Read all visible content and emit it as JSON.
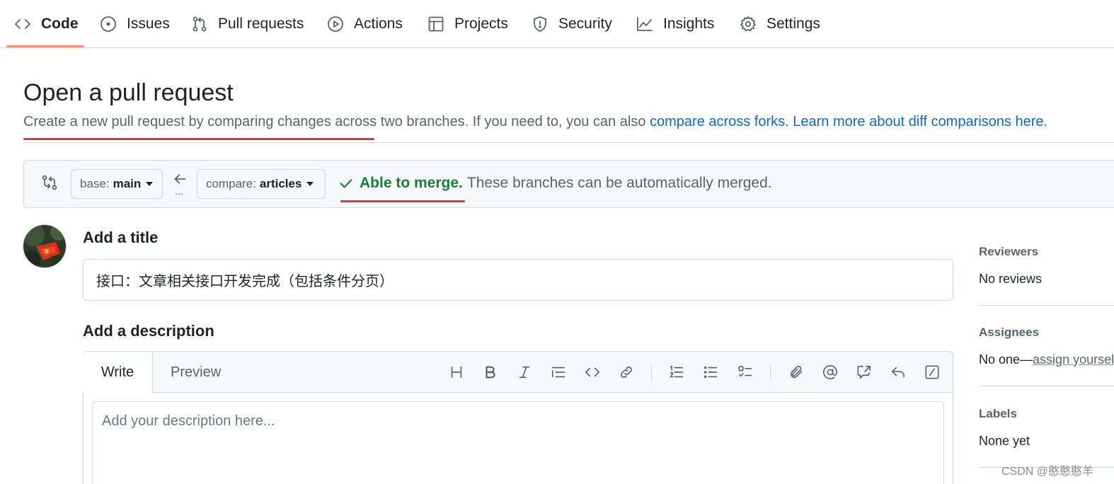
{
  "nav": {
    "items": [
      {
        "label": "Code",
        "icon": "code-icon"
      },
      {
        "label": "Issues",
        "icon": "issue-icon"
      },
      {
        "label": "Pull requests",
        "icon": "pull-request-icon"
      },
      {
        "label": "Actions",
        "icon": "play-icon"
      },
      {
        "label": "Projects",
        "icon": "table-icon"
      },
      {
        "label": "Security",
        "icon": "shield-icon"
      },
      {
        "label": "Insights",
        "icon": "graph-icon"
      },
      {
        "label": "Settings",
        "icon": "gear-icon"
      }
    ],
    "active": "Code"
  },
  "header": {
    "title": "Open a pull request",
    "subtitle_text": "Create a new pull request by comparing changes across two branches. If you need to, you can also ",
    "compare_forks_link": "compare across forks.",
    "learn_more_link": "Learn more about diff comparisons here."
  },
  "compare": {
    "base_prefix": "base:",
    "base_branch": "main",
    "compare_prefix": "compare:",
    "compare_branch": "articles",
    "dots": "...",
    "merge_ok": "Able to merge.",
    "merge_text": "These branches can be automatically merged."
  },
  "form": {
    "title_heading": "Add a title",
    "title_value": "接口：文章相关接口开发完成（包括条件分页）",
    "description_heading": "Add a description",
    "write_tab": "Write",
    "preview_tab": "Preview",
    "description_placeholder": "Add your description here..."
  },
  "sidebar": {
    "reviewers_heading": "Reviewers",
    "reviewers_value": "No reviews",
    "assignees_heading": "Assignees",
    "assignees_prefix": "No one—",
    "assignees_link": "assign yourself",
    "labels_heading": "Labels",
    "labels_value": "None yet"
  },
  "watermark": "CSDN @憨憨憨羊",
  "colors": {
    "accent_link": "#0969da",
    "success": "#1a7f37",
    "nav_underline": "#fd8c73",
    "annotation_red": "#d73a3a"
  }
}
